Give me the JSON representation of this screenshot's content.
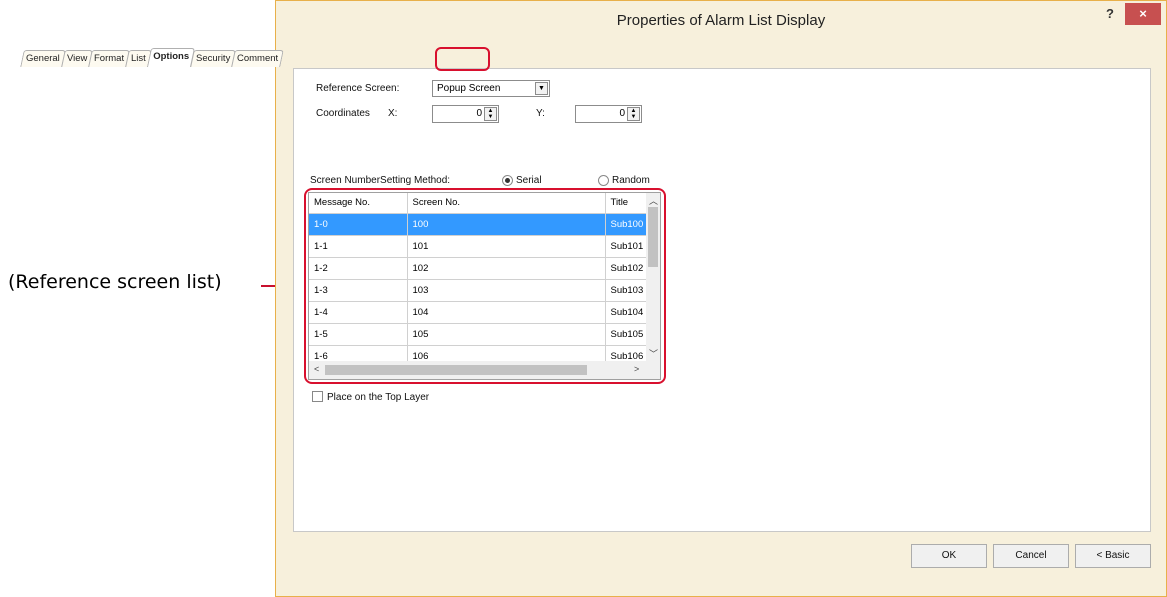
{
  "callout": {
    "label": "(Reference screen list)"
  },
  "window": {
    "title": "Properties of Alarm List Display",
    "help_label": "?",
    "close_label": "×"
  },
  "tabs": [
    {
      "label": "General"
    },
    {
      "label": "View"
    },
    {
      "label": "Format"
    },
    {
      "label": "List"
    },
    {
      "label": "Options",
      "active": true
    },
    {
      "label": "Security"
    },
    {
      "label": "Comment"
    }
  ],
  "options": {
    "reference_screen_label": "Reference Screen:",
    "reference_screen_value": "Popup Screen",
    "coordinates_label": "Coordinates",
    "x_label": "X:",
    "x_value": "0",
    "y_label": "Y:",
    "y_value": "0",
    "setting_method_label": "Screen NumberSetting Method:",
    "serial_label": "Serial",
    "random_label": "Random",
    "selected_method": "Serial"
  },
  "list": {
    "columns": [
      "Message No.",
      "Screen No.",
      "Title"
    ],
    "rows": [
      [
        "1-0",
        "100",
        "Sub100"
      ],
      [
        "1-1",
        "101",
        "Sub101"
      ],
      [
        "1-2",
        "102",
        "Sub102"
      ],
      [
        "1-3",
        "103",
        "Sub103"
      ],
      [
        "1-4",
        "104",
        "Sub104"
      ],
      [
        "1-5",
        "105",
        "Sub105"
      ],
      [
        "1-6",
        "106",
        "Sub106"
      ]
    ],
    "selected_row": 0
  },
  "place_top_layer_label": "Place on the Top Layer",
  "buttons": {
    "ok": "OK",
    "cancel": "Cancel",
    "basic": "< Basic"
  }
}
